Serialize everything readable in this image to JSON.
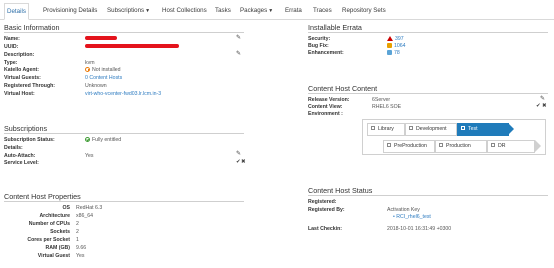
{
  "tabs": [
    {
      "label": "Details"
    },
    {
      "label": "Provisioning Details"
    },
    {
      "label": "Subscriptions"
    },
    {
      "label": "Host Collections"
    },
    {
      "label": "Tasks"
    },
    {
      "label": "Packages"
    },
    {
      "label": "Errata"
    },
    {
      "label": "Traces"
    },
    {
      "label": "Repository Sets"
    }
  ],
  "basic": {
    "title": "Basic Information",
    "name_label": "Name:",
    "uuid_label": "UUID:",
    "description_label": "Description:",
    "type_label": "Type:",
    "type_value": "kvm",
    "katello_label": "Katello Agent:",
    "katello_value": "Not installed",
    "guests_label": "Virtual Guests:",
    "guests_value": "0 Content Hosts",
    "registered_label": "Registered Through:",
    "registered_value": "Unknown",
    "vhost_label": "Virtual Host:",
    "vhost_value": "virt-who-vcenter-fwd03.lr.lcm.in-3"
  },
  "subs": {
    "title": "Subscriptions",
    "status_label": "Subscription Status:",
    "status_value": "Fully entitled",
    "details_label": "Details:",
    "autoattach_label": "Auto-Attach:",
    "autoattach_value": "Yes",
    "service_label": "Service Level:"
  },
  "props": {
    "title": "Content Host Properties",
    "rows": [
      {
        "label": "OS",
        "value": "RedHat 6.3"
      },
      {
        "label": "Architecture",
        "value": "x86_64"
      },
      {
        "label": "Number of CPUs",
        "value": "2"
      },
      {
        "label": "Sockets",
        "value": "2"
      },
      {
        "label": "Cores per Socket",
        "value": "1"
      },
      {
        "label": "RAM (GB)",
        "value": "9.66"
      },
      {
        "label": "Virtual Guest",
        "value": "Yes"
      }
    ]
  },
  "errata": {
    "title": "Installable Errata",
    "security_label": "Security:",
    "security_value": "397",
    "bugfix_label": "Bug Fix:",
    "bugfix_value": "1064",
    "enh_label": "Enhancement:",
    "enh_value": "78"
  },
  "content": {
    "title": "Content Host Content",
    "release_label": "Release Version:",
    "release_value": "6Server",
    "view_label": "Content View:",
    "view_value": "RHEL6 SOE",
    "env_label": "Environment :",
    "envs": [
      "Library",
      "Development",
      "Test",
      "PreProduction",
      "Production",
      "DR"
    ]
  },
  "status": {
    "title": "Content Host Status",
    "registered_label": "Registered:",
    "registered_by_label": "Registered By:",
    "registered_by_value": "Activation Key",
    "key_value": "RCI_rhel6_test",
    "checkin_label": "Last Checkin:",
    "checkin_value": "2018-10-01 16:31:49 +0300"
  },
  "colors": {
    "link": "#2d7bc0",
    "active_env": "#1f7bba",
    "redaction": "#e4131c"
  }
}
